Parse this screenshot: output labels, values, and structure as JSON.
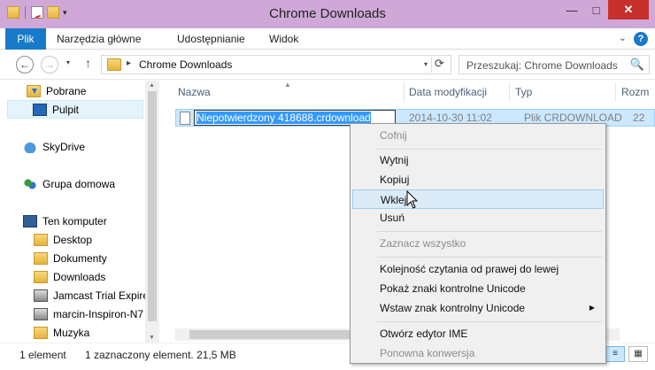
{
  "window": {
    "title": "Chrome Downloads",
    "minimize": "—",
    "maximize": "□",
    "close": "✕"
  },
  "ribbon": {
    "tabs": [
      "Plik",
      "Narzędzia główne",
      "Udostępnianie",
      "Widok"
    ],
    "help": "?",
    "collapse": "⌄"
  },
  "address": {
    "path": "Chrome Downloads",
    "crumb_sep": "▸",
    "refresh": "⟳",
    "search_placeholder": "Przeszukaj: Chrome Downloads",
    "search_icon": "🔍"
  },
  "nav": {
    "back": "←",
    "forward": "→",
    "recent": "▾",
    "up": "↑",
    "items": [
      {
        "label": "Pobrane",
        "icon": "downloads-folder-icon",
        "selected": false
      },
      {
        "label": "Pulpit",
        "icon": "desktop-icon",
        "selected": true
      },
      {
        "label": "SkyDrive",
        "icon": "cloud-icon",
        "selected": false
      },
      {
        "label": "Grupa domowa",
        "icon": "homegroup-icon",
        "selected": false
      },
      {
        "label": "Ten komputer",
        "icon": "computer-icon",
        "selected": false
      },
      {
        "label": "Desktop",
        "icon": "folder-icon",
        "selected": false
      },
      {
        "label": "Dokumenty",
        "icon": "folder-icon",
        "selected": false
      },
      {
        "label": "Downloads",
        "icon": "folder-icon",
        "selected": false
      },
      {
        "label": "Jamcast Trial Expired",
        "icon": "network-computer-icon",
        "selected": false
      },
      {
        "label": "marcin-Inspiron-N7",
        "icon": "network-computer-icon",
        "selected": false
      },
      {
        "label": "Muzyka",
        "icon": "folder-icon",
        "selected": false
      }
    ]
  },
  "files": {
    "columns": [
      "Nazwa",
      "Data modyfikacji",
      "Typ",
      "Rozm"
    ],
    "rows": [
      {
        "name": "Niepotwierdzony 418688.crdownload",
        "modified": "2014-10-30 11:02",
        "type": "Plik CRDOWNLOAD",
        "size": "22"
      }
    ]
  },
  "context_menu": {
    "items": [
      {
        "label": "Cofnij",
        "disabled": true
      },
      {
        "label": "Wytnij",
        "disabled": false
      },
      {
        "label": "Kopiuj",
        "disabled": false
      },
      {
        "label": "Wklej",
        "disabled": false,
        "hover": true
      },
      {
        "label": "Usuń",
        "disabled": false
      },
      {
        "label": "Zaznacz wszystko",
        "disabled": true
      },
      {
        "label": "Kolejność czytania od prawej do lewej",
        "disabled": false
      },
      {
        "label": "Pokaż znaki kontrolne Unicode",
        "disabled": false
      },
      {
        "label": "Wstaw znak kontrolny Unicode",
        "disabled": false,
        "submenu": true
      },
      {
        "label": "Otwórz edytor IME",
        "disabled": false
      },
      {
        "label": "Ponowna konwersja",
        "disabled": true
      }
    ]
  },
  "status": {
    "count": "1 element",
    "selection": "1 zaznaczony element. 21,5 MB"
  },
  "colors": {
    "accent": "#1979ca",
    "selection": "#cce8ff",
    "title_bar": "#d0a8d8",
    "close_button": "#c7302b"
  }
}
